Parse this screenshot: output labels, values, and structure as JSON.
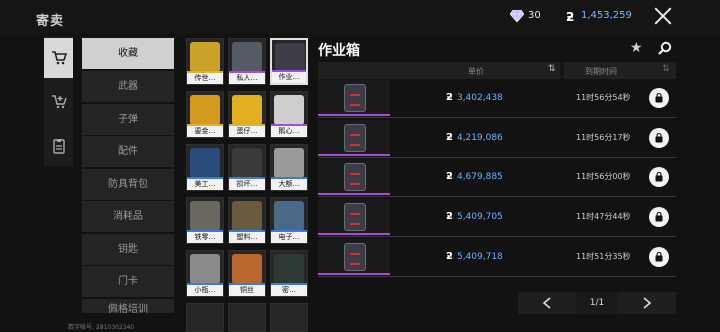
{
  "header": {
    "title": "寄卖",
    "gems": "30",
    "coins": "1,453,259"
  },
  "categories": [
    "收藏",
    "武器",
    "子弹",
    "配件",
    "防具背包",
    "消耗品",
    "钥匙",
    "门卡",
    "佩格培训"
  ],
  "grid": [
    {
      "label": "传世…",
      "color": "#c9a227",
      "bar": "#e0b030"
    },
    {
      "label": "私人…",
      "color": "#555a66",
      "bar": "#a04fd6"
    },
    {
      "label": "作业…",
      "color": "#3d3d48",
      "bar": "#a04fd6"
    },
    {
      "label": "鎏金…",
      "color": "#d49a20",
      "bar": "#e0b030"
    },
    {
      "label": "蛋仔…",
      "color": "#e0b020",
      "bar": "#e0b030"
    },
    {
      "label": "鹅心…",
      "color": "#cfcfcf",
      "bar": "#a04fd6"
    },
    {
      "label": "美工…",
      "color": "#2a4a7a",
      "bar": "#3a7bd5"
    },
    {
      "label": "损坏…",
      "color": "#3a3a3a",
      "bar": "#3a7bd5"
    },
    {
      "label": "大额…",
      "color": "#9a9a9a",
      "bar": "#3a7bd5"
    },
    {
      "label": "铁零…",
      "color": "#6a6660",
      "bar": "#3a7bd5"
    },
    {
      "label": "塑料…",
      "color": "#6a5a40",
      "bar": "#3a7bd5"
    },
    {
      "label": "电子…",
      "color": "#4a6a8a",
      "bar": "#3a7bd5"
    },
    {
      "label": "小瓶…",
      "color": "#8a8a8a",
      "bar": "#3a7bd5"
    },
    {
      "label": "铜丝",
      "color": "#b8682e",
      "bar": "#3a7bd5"
    },
    {
      "label": "密…",
      "color": "#2e3a34",
      "bar": "#3a7bd5"
    }
  ],
  "panel": {
    "title": "作业箱",
    "col_price": "单价",
    "col_time": "到期时间",
    "rows": [
      {
        "price": "3,402,438",
        "time": "11时56分54秒"
      },
      {
        "price": "4,219,086",
        "time": "11时56分17秒"
      },
      {
        "price": "4,679,885",
        "time": "11时56分00秒"
      },
      {
        "price": "5,409,705",
        "time": "11时47分44秒"
      },
      {
        "price": "5,409,718",
        "time": "11时51分35秒"
      }
    ],
    "page": "1/1"
  },
  "uid": "数字帐号: 2810302340"
}
